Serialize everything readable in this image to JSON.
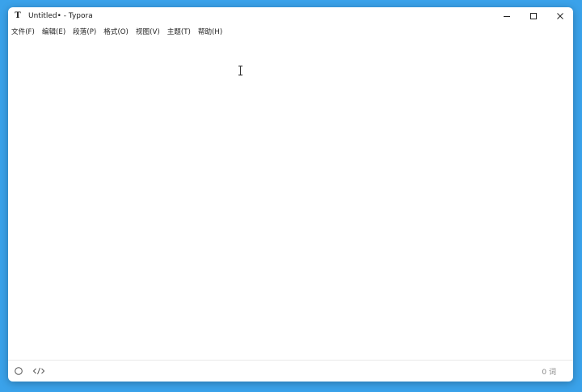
{
  "window": {
    "app_icon_glyph": "T",
    "title": "Untitled• - Typora"
  },
  "controls": {
    "minimize_icon": "minimize-icon",
    "maximize_icon": "maximize-icon",
    "close_icon": "close-icon"
  },
  "menu": {
    "items": [
      {
        "label": "文件(F)"
      },
      {
        "label": "编辑(E)"
      },
      {
        "label": "段落(P)"
      },
      {
        "label": "格式(O)"
      },
      {
        "label": "视图(V)"
      },
      {
        "label": "主题(T)"
      },
      {
        "label": "帮助(H)"
      }
    ]
  },
  "editor": {
    "content": ""
  },
  "status": {
    "outline_icon": "circle-icon",
    "source_icon": "code-icon",
    "word_count": "0 词"
  },
  "colors": {
    "desktop": "#3aa2ea",
    "window": "#ffffff"
  }
}
